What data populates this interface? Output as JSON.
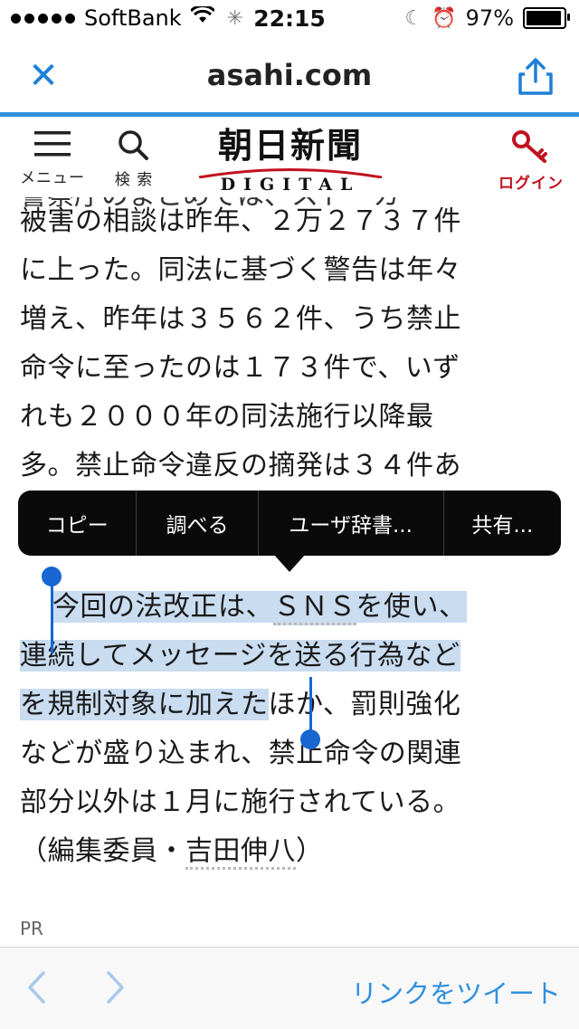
{
  "status_bar": {
    "carrier": "SoftBank",
    "time": "22:15",
    "battery": "97%",
    "icons": [
      "signal-dots-icon",
      "wifi-icon",
      "activity-spinner-icon",
      "moon-icon",
      "alarm-icon",
      "battery-icon"
    ]
  },
  "browser": {
    "title": "asahi.com",
    "close_icon": "close-icon",
    "share_icon": "share-icon",
    "accent_color": "#2f8fde"
  },
  "site_header": {
    "menu_label": "メニュー",
    "search_label": "検 索",
    "logo_main": "朝日新聞",
    "logo_sub": "DIGITAL",
    "login_label": "ログイン",
    "login_color": "#c1121f"
  },
  "article": {
    "clipped_line": "警察庁のまとめでは、ストーカ",
    "lines": [
      "被害の相談は昨年、２万２７３７件",
      "に上った。同法に基づく警告は年々",
      "増え、昨年は３５６２件、うち禁止",
      "命令に至ったのは１７３件で、いず",
      "れも２０００年の同法施行以降最"
    ],
    "clipped_bottom": "多。禁止命令違反の摘発は３４件あ",
    "para2": {
      "line1_pre": "今回の法改正は、",
      "line1_link": "ＳＮＳ",
      "line1_post": "を使い、",
      "line2": "連続してメッセージを送る行為など",
      "line3_sel": "を規制対象に加えた",
      "line3_rest": "ほか、罰則強化",
      "line4": "などが盛り込まれ、禁止命令の関連",
      "line5": "部分以外は１月に施行されている。",
      "byline_pre": "（編集委員・",
      "byline_name": "吉田伸八",
      "byline_post": "）"
    },
    "pr_label": "PR",
    "selection_color": "#c9dcf0"
  },
  "context_menu": {
    "items": [
      "コピー",
      "調べる",
      "ユーザ辞書...",
      "共有..."
    ]
  },
  "toolbar": {
    "back_icon": "chevron-left-icon",
    "forward_icon": "chevron-right-icon",
    "tweet_label": "リンクをツイート"
  }
}
